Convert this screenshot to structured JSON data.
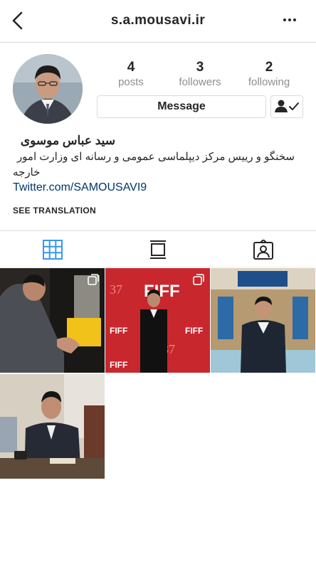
{
  "header": {
    "username": "s.a.mousavi.ir",
    "back_icon": "chevron-left-icon",
    "more_icon": "more-horizontal-icon"
  },
  "stats": [
    {
      "count": "4",
      "label": "posts"
    },
    {
      "count": "3",
      "label": "followers"
    },
    {
      "count": "2",
      "label": "following"
    }
  ],
  "buttons": {
    "message": "Message",
    "following_icon": "person-check-icon"
  },
  "profile": {
    "name": "سید عباس موسوی",
    "bio_line1": "سخنگو و رییس مرکز دیپلماسی عمومی و رسانه ای وزارت امور",
    "bio_line2": "خارجه",
    "link": "Twitter.com/SAMOUSAVI9",
    "see_translation": "SEE TRANSLATION"
  },
  "tabs": [
    {
      "icon": "grid-icon",
      "active": true
    },
    {
      "icon": "feed-icon",
      "active": false
    },
    {
      "icon": "tagged-icon",
      "active": false
    }
  ],
  "posts": [
    {
      "subject": "leaning-over-document"
    },
    {
      "subject": "film-festival-red-carpet",
      "sign_text": "FIFF"
    },
    {
      "subject": "building-courtyard"
    },
    {
      "subject": "office-desk-phone"
    }
  ],
  "colors": {
    "link": "#003569",
    "active_tab": "#3897f0",
    "muted": "#8e8e8e",
    "border": "#dbdbdb"
  }
}
